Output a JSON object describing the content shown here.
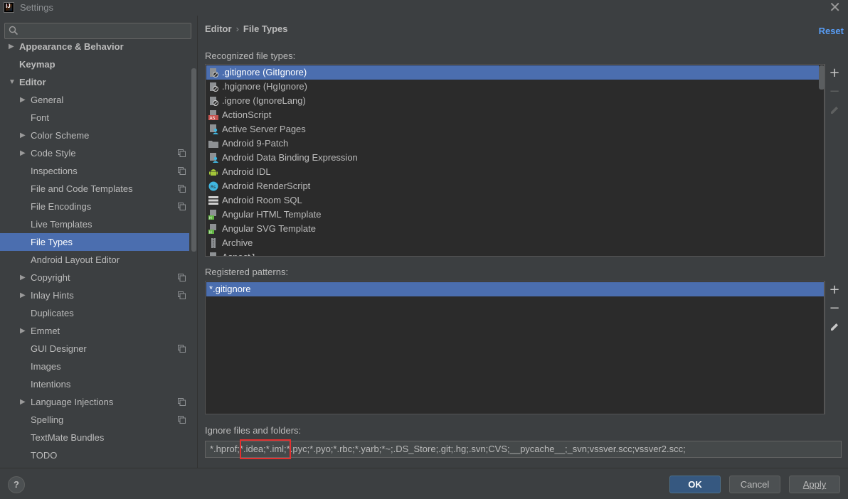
{
  "window": {
    "title": "Settings"
  },
  "search": {
    "value": "",
    "placeholder": ""
  },
  "tree": [
    {
      "label": "Appearance & Behavior",
      "arrow": "▶",
      "bold": true
    },
    {
      "label": "Keymap",
      "arrow": "",
      "bold": true
    },
    {
      "label": "Editor",
      "arrow": "▼",
      "bold": true
    },
    {
      "label": "General",
      "arrow": "▶",
      "copy": false
    },
    {
      "label": "Font",
      "arrow": "",
      "copy": false
    },
    {
      "label": "Color Scheme",
      "arrow": "▶",
      "copy": false
    },
    {
      "label": "Code Style",
      "arrow": "▶",
      "copy": true
    },
    {
      "label": "Inspections",
      "arrow": "",
      "copy": true
    },
    {
      "label": "File and Code Templates",
      "arrow": "",
      "copy": true
    },
    {
      "label": "File Encodings",
      "arrow": "",
      "copy": true
    },
    {
      "label": "Live Templates",
      "arrow": "",
      "copy": false
    },
    {
      "label": "File Types",
      "arrow": "",
      "copy": false,
      "selected": true
    },
    {
      "label": "Android Layout Editor",
      "arrow": "",
      "copy": false
    },
    {
      "label": "Copyright",
      "arrow": "▶",
      "copy": true
    },
    {
      "label": "Inlay Hints",
      "arrow": "▶",
      "copy": true
    },
    {
      "label": "Duplicates",
      "arrow": "",
      "copy": false
    },
    {
      "label": "Emmet",
      "arrow": "▶",
      "copy": false
    },
    {
      "label": "GUI Designer",
      "arrow": "",
      "copy": true
    },
    {
      "label": "Images",
      "arrow": "",
      "copy": false
    },
    {
      "label": "Intentions",
      "arrow": "",
      "copy": false
    },
    {
      "label": "Language Injections",
      "arrow": "▶",
      "copy": true
    },
    {
      "label": "Spelling",
      "arrow": "",
      "copy": true
    },
    {
      "label": "TextMate Bundles",
      "arrow": "",
      "copy": false
    },
    {
      "label": "TODO",
      "arrow": "",
      "copy": false
    }
  ],
  "breadcrumb": {
    "parent": "Editor",
    "separator": "›",
    "current": "File Types"
  },
  "reset_label": "Reset",
  "recognized": {
    "label": "Recognized file types:",
    "items": [
      {
        "label": ".gitignore (GitIgnore)",
        "icon": "git-file-icon",
        "selected": true
      },
      {
        "label": ".hgignore (HgIgnore)",
        "icon": "ignore-file-icon"
      },
      {
        "label": ".ignore (IgnoreLang)",
        "icon": "ignore-file-icon"
      },
      {
        "label": "ActionScript",
        "icon": "actionscript-icon"
      },
      {
        "label": "Active Server Pages",
        "icon": "asp-icon"
      },
      {
        "label": "Android 9-Patch",
        "icon": "folder-icon"
      },
      {
        "label": "Android Data Binding Expression",
        "icon": "binding-icon"
      },
      {
        "label": "Android IDL",
        "icon": "android-icon"
      },
      {
        "label": "Android RenderScript",
        "icon": "renderscript-icon"
      },
      {
        "label": "Android Room SQL",
        "icon": "sql-icon"
      },
      {
        "label": "Angular HTML Template",
        "icon": "angular-html-icon"
      },
      {
        "label": "Angular SVG Template",
        "icon": "angular-svg-icon"
      },
      {
        "label": "Archive",
        "icon": "archive-icon"
      },
      {
        "label": "AspectJ",
        "icon": "aspectj-icon"
      }
    ]
  },
  "patterns": {
    "label": "Registered patterns:",
    "items": [
      {
        "label": "*.gitignore",
        "selected": true
      }
    ]
  },
  "ignore": {
    "label": "Ignore files and folders:",
    "value": "*.hprof;*.idea;*.iml;*.pyc;*.pyo;*.rbc;*.yarb;*~;.DS_Store;.git;.hg;.svn;CVS;__pycache__;_svn;vssver.scc;vssver2.scc;"
  },
  "buttons": {
    "help": "?",
    "ok": "OK",
    "cancel": "Cancel",
    "apply": "Apply"
  },
  "colors": {
    "selection": "#4b6eaf",
    "link": "#589df6",
    "highlight": "#e3302f",
    "background": "#3c3f41"
  }
}
